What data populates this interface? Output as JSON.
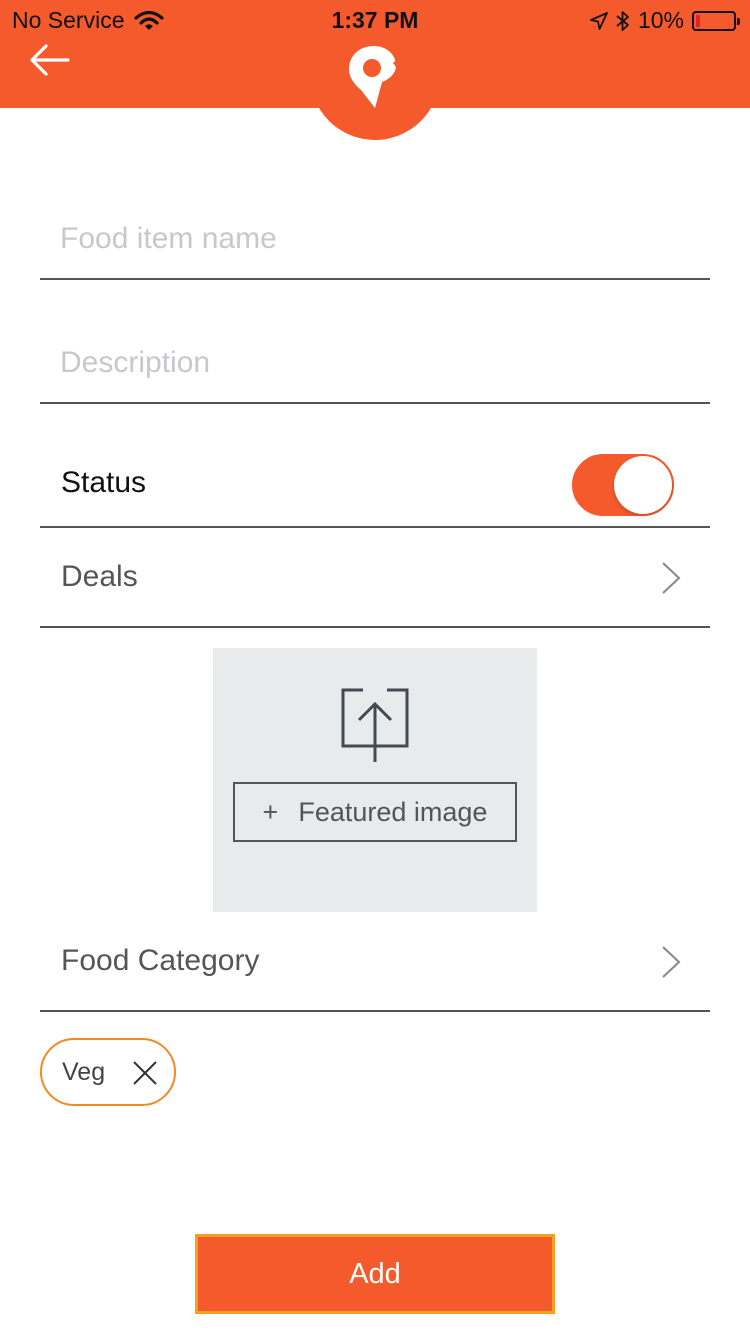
{
  "status_bar": {
    "carrier": "No Service",
    "time": "1:37 PM",
    "battery_percent_label": "10%",
    "battery_level": 0.1
  },
  "header": {
    "back_icon": "arrow-left-icon",
    "logo_icon": "location-pin-logo",
    "background_color": "#f55a2c"
  },
  "form": {
    "food_item_name": {
      "value": "",
      "placeholder": "Food item name"
    },
    "description": {
      "value": "",
      "placeholder": "Description"
    },
    "status": {
      "label": "Status",
      "enabled": true
    },
    "deals": {
      "label": "Deals"
    },
    "featured_image": {
      "button_plus": "+",
      "button_label": "Featured image",
      "icon": "upload-icon"
    },
    "food_category": {
      "label": "Food Category"
    },
    "selected_categories": [
      {
        "label": "Veg"
      }
    ]
  },
  "actions": {
    "add_label": "Add"
  },
  "colors": {
    "accent": "#f55a2c",
    "chip_border": "#f08a24",
    "button_border": "#f5a020"
  }
}
